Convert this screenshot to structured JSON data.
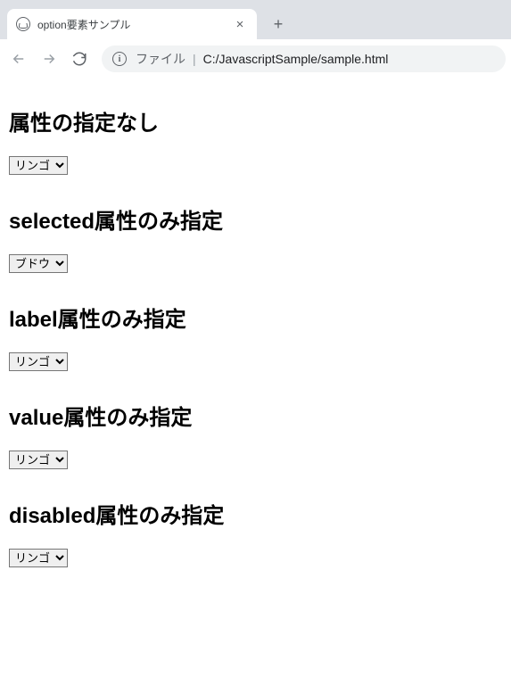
{
  "browser": {
    "tab_title": "option要素サンプル",
    "address_prefix": "ファイル",
    "address_path": "C:/JavascriptSample/sample.html"
  },
  "sections": [
    {
      "heading": "属性の指定なし",
      "selected": "リンゴ"
    },
    {
      "heading": "selected属性のみ指定",
      "selected": "ブドウ"
    },
    {
      "heading": "label属性のみ指定",
      "selected": "リンゴ"
    },
    {
      "heading": "value属性のみ指定",
      "selected": "リンゴ"
    },
    {
      "heading": "disabled属性のみ指定",
      "selected": "リンゴ"
    }
  ]
}
